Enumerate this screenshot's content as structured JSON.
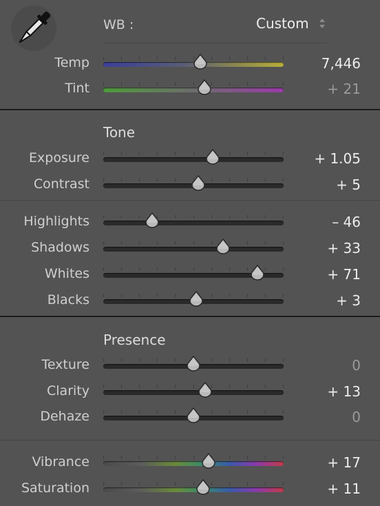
{
  "wb": {
    "label": "WB :",
    "mode": "Custom",
    "eyedropper_icon": "eyedropper-icon",
    "dropdown_icon": "updown-arrows-icon"
  },
  "sections": {
    "tone": "Tone",
    "presence": "Presence"
  },
  "sliders": [
    {
      "key": "temp",
      "label": "Temp",
      "value": "7,446",
      "fraction": 0.54,
      "gradient": "temp"
    },
    {
      "key": "tint",
      "label": "Tint",
      "value": "+ 21",
      "fraction": 0.56,
      "gradient": "tint",
      "dim": true
    },
    {
      "key": "exposure",
      "label": "Exposure",
      "value": "+ 1.05",
      "fraction": 0.605
    },
    {
      "key": "contrast",
      "label": "Contrast",
      "value": "+ 5",
      "fraction": 0.525
    },
    {
      "key": "highlights",
      "label": "Highlights",
      "value": "– 46",
      "fraction": 0.27
    },
    {
      "key": "shadows",
      "label": "Shadows",
      "value": "+ 33",
      "fraction": 0.665
    },
    {
      "key": "whites",
      "label": "Whites",
      "value": "+ 71",
      "fraction": 0.855
    },
    {
      "key": "blacks",
      "label": "Blacks",
      "value": "+ 3",
      "fraction": 0.515
    },
    {
      "key": "texture",
      "label": "Texture",
      "value": "0",
      "fraction": 0.5,
      "dim": true
    },
    {
      "key": "clarity",
      "label": "Clarity",
      "value": "+ 13",
      "fraction": 0.565
    },
    {
      "key": "dehaze",
      "label": "Dehaze",
      "value": "0",
      "fraction": 0.5,
      "dim": true
    },
    {
      "key": "vibrance",
      "label": "Vibrance",
      "value": "+ 17",
      "fraction": 0.585,
      "gradient": "color"
    },
    {
      "key": "saturation",
      "label": "Saturation",
      "value": "+ 11",
      "fraction": 0.555,
      "gradient": "color"
    }
  ],
  "colors": {
    "panel_bg": "#535353",
    "track_dark": "#2a2a2a",
    "thumb": "#b8b8b8"
  }
}
